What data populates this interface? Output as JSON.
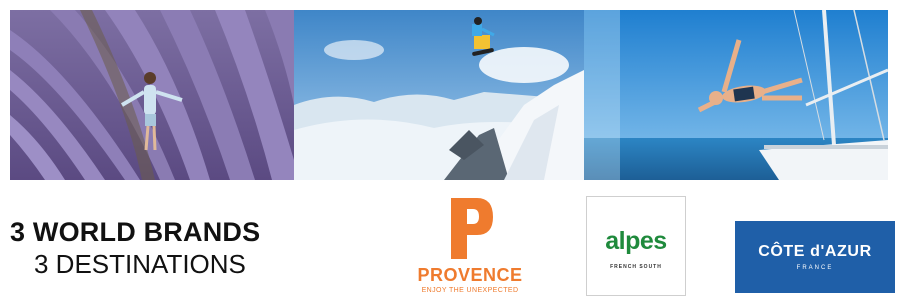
{
  "headline": {
    "line1": "3 WORLD BRANDS",
    "line2": "3 DESTINATIONS"
  },
  "brands": {
    "provence": {
      "name": "PROVENCE",
      "tagline": "ENJOY THE UNEXPECTED",
      "color": "#ef7b2e"
    },
    "alpes": {
      "name": "alpes",
      "subtitle": "FRENCH SOUTH",
      "color": "#1f8a3c"
    },
    "cote_azur": {
      "name": "CÔTE d'AZUR",
      "subtitle": "FRANCE",
      "color": "#1f5fa8"
    }
  },
  "photos": [
    {
      "subject": "lavender-field-child"
    },
    {
      "subject": "alps-snowboarder"
    },
    {
      "subject": "sea-diver-sailboat"
    }
  ]
}
